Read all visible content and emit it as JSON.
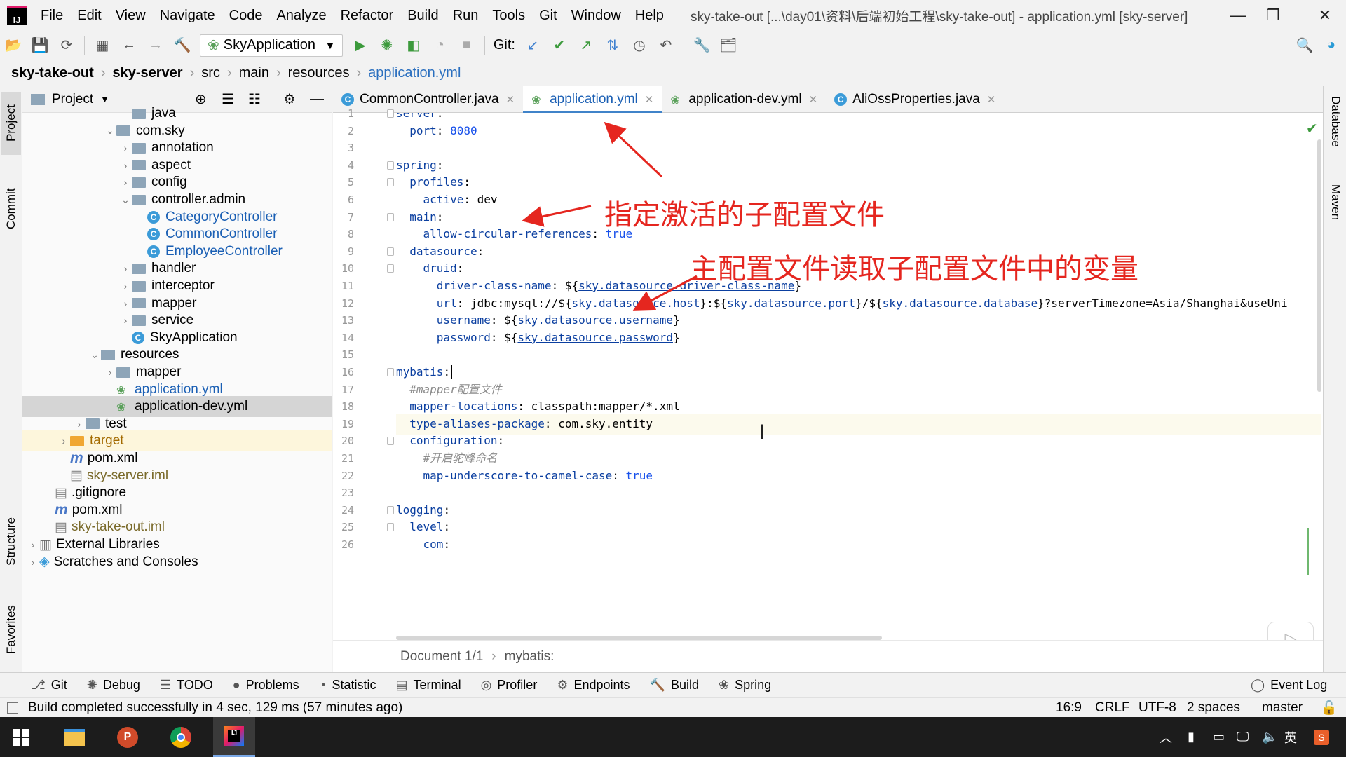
{
  "menubar": {
    "items": [
      "File",
      "Edit",
      "View",
      "Navigate",
      "Code",
      "Analyze",
      "Refactor",
      "Build",
      "Run",
      "Tools",
      "Git",
      "Window",
      "Help"
    ],
    "title": "sky-take-out [...\\day01\\资料\\后端初始工程\\sky-take-out] - application.yml [sky-server]"
  },
  "toolbar": {
    "run_config": "SkyApplication",
    "git_label": "Git:"
  },
  "breadcrumb": [
    "sky-take-out",
    "sky-server",
    "src",
    "main",
    "resources",
    "application.yml"
  ],
  "left_strip": {
    "project": "Project",
    "commit": "Commit",
    "structure": "Structure",
    "favorites": "Favorites"
  },
  "right_strip": {
    "database": "Database",
    "maven": "Maven"
  },
  "project_panel": {
    "title": "Project",
    "tree": [
      {
        "label": "java",
        "indent": 6,
        "arrow": "",
        "icon": "folder"
      },
      {
        "label": "com.sky",
        "indent": 5,
        "arrow": "▾",
        "icon": "pkg"
      },
      {
        "label": "annotation",
        "indent": 6,
        "arrow": "›",
        "icon": "pkg"
      },
      {
        "label": "aspect",
        "indent": 6,
        "arrow": "›",
        "icon": "pkg"
      },
      {
        "label": "config",
        "indent": 6,
        "arrow": "›",
        "icon": "pkg"
      },
      {
        "label": "controller.admin",
        "indent": 6,
        "arrow": "▾",
        "icon": "pkg"
      },
      {
        "label": "CategoryController",
        "indent": 7,
        "arrow": "",
        "icon": "class"
      },
      {
        "label": "CommonController",
        "indent": 7,
        "arrow": "",
        "icon": "class"
      },
      {
        "label": "EmployeeController",
        "indent": 7,
        "arrow": "",
        "icon": "class"
      },
      {
        "label": "handler",
        "indent": 6,
        "arrow": "›",
        "icon": "pkg"
      },
      {
        "label": "interceptor",
        "indent": 6,
        "arrow": "›",
        "icon": "pkg"
      },
      {
        "label": "mapper",
        "indent": 6,
        "arrow": "›",
        "icon": "pkg"
      },
      {
        "label": "service",
        "indent": 6,
        "arrow": "›",
        "icon": "pkg"
      },
      {
        "label": "SkyApplication",
        "indent": 6,
        "arrow": "",
        "icon": "class"
      },
      {
        "label": "resources",
        "indent": 4,
        "arrow": "▾",
        "icon": "folder"
      },
      {
        "label": "mapper",
        "indent": 5,
        "arrow": "›",
        "icon": "folder"
      },
      {
        "label": "application.yml",
        "indent": 5,
        "arrow": "",
        "icon": "yml"
      },
      {
        "label": "application-dev.yml",
        "indent": 5,
        "arrow": "",
        "icon": "yml"
      },
      {
        "label": "test",
        "indent": 3,
        "arrow": "›",
        "icon": "folder"
      },
      {
        "label": "target",
        "indent": 2,
        "arrow": "›",
        "icon": "orange"
      },
      {
        "label": "pom.xml",
        "indent": 2,
        "arrow": "",
        "icon": "m"
      },
      {
        "label": "sky-server.iml",
        "indent": 2,
        "arrow": "",
        "icon": "iml"
      },
      {
        "label": ".gitignore",
        "indent": 1,
        "arrow": "",
        "icon": "iml"
      },
      {
        "label": "pom.xml",
        "indent": 1,
        "arrow": "",
        "icon": "m"
      },
      {
        "label": "sky-take-out.iml",
        "indent": 1,
        "arrow": "",
        "icon": "iml"
      },
      {
        "label": "External Libraries",
        "indent": 0,
        "arrow": "›",
        "icon": "lib"
      },
      {
        "label": "Scratches and Consoles",
        "indent": 0,
        "arrow": "›",
        "icon": "scratch"
      }
    ]
  },
  "editor_tabs": [
    {
      "label": "CommonController.java",
      "icon": "class",
      "active": false
    },
    {
      "label": "application.yml",
      "icon": "yml",
      "active": true
    },
    {
      "label": "application-dev.yml",
      "icon": "yml",
      "active": false
    },
    {
      "label": "AliOssProperties.java",
      "icon": "class",
      "active": false
    }
  ],
  "code_lines": [
    "server:",
    "  port: 8080",
    "",
    "spring:",
    "  profiles:",
    "    active: dev",
    "  main:",
    "    allow-circular-references: true",
    "  datasource:",
    "    druid:",
    "      driver-class-name: ${sky.datasource.driver-class-name}",
    "      url: jdbc:mysql://${sky.datasource.host}:${sky.datasource.port}/${sky.datasource.database}?serverTimezone=Asia/Shanghai&useUni",
    "      username: ${sky.datasource.username}",
    "      password: ${sky.datasource.password}",
    "",
    "mybatis:",
    "  #mapper配置文件",
    "  mapper-locations: classpath:mapper/*.xml",
    "  type-aliases-package: com.sky.entity",
    "  configuration:",
    "    #开启驼峰命名",
    "    map-underscore-to-camel-case: true",
    "",
    "logging:",
    "  level:",
    "    com:"
  ],
  "annotations": {
    "a1": "指定激活的子配置文件",
    "a2": "主配置文件读取子配置文件中的变量"
  },
  "editor_breadcrumb": {
    "doc": "Document 1/1",
    "path": "mybatis:"
  },
  "bottom_tools": [
    "Git",
    "Debug",
    "TODO",
    "Problems",
    "Statistic",
    "Terminal",
    "Profiler",
    "Endpoints",
    "Build",
    "Spring"
  ],
  "event_log": "Event Log",
  "status": {
    "message": "Build completed successfully in 4 sec, 129 ms (57 minutes ago)",
    "position": "16:9",
    "line_sep": "CRLF",
    "encoding": "UTF-8",
    "indent": "2 spaces",
    "branch": "master"
  },
  "taskbar": {
    "ime": "英"
  },
  "colors": {
    "accent": "#4083c9",
    "annotation": "#e5261f",
    "key": "#0b3fa0",
    "value": "#067d17"
  }
}
